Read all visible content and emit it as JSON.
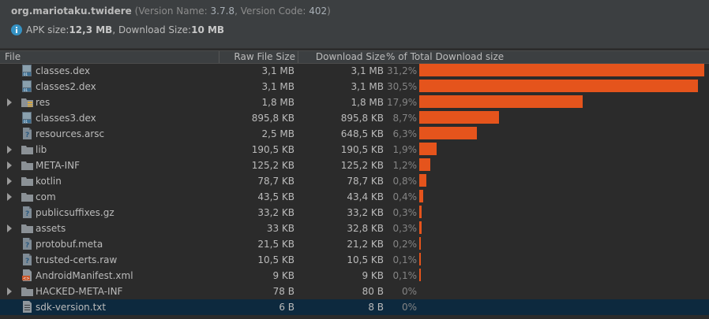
{
  "app": {
    "package": "org.mariotaku.twidere",
    "version_prefix": " (Version Name: ",
    "version_name": "3.7.8",
    "version_mid": ", Version Code: ",
    "version_code": "402",
    "version_suffix": ")"
  },
  "sizes": {
    "apk_label": "APK size: ",
    "apk_value": "12,3 MB",
    "download_label": ", Download Size: ",
    "download_value": "10 MB"
  },
  "columns": {
    "file": "File",
    "raw": "Raw File Size",
    "download": "Download Size",
    "percent": "% of Total Download size"
  },
  "colors": {
    "bar": "#e5541c",
    "selected_row": "#0d293e",
    "background": "#2b2b2b"
  },
  "files": [
    {
      "name": "classes.dex",
      "raw": "3,1 MB",
      "download": "3,1 MB",
      "percent": "31,2%",
      "share": 31.2,
      "expandable": false,
      "icon": "dex-file-icon"
    },
    {
      "name": "classes2.dex",
      "raw": "3,1 MB",
      "download": "3,1 MB",
      "percent": "30,5%",
      "share": 30.5,
      "expandable": false,
      "icon": "dex-file-icon"
    },
    {
      "name": "res",
      "raw": "1,8 MB",
      "download": "1,8 MB",
      "percent": "17,9%",
      "share": 17.9,
      "expandable": true,
      "icon": "resource-folder-icon"
    },
    {
      "name": "classes3.dex",
      "raw": "895,8 KB",
      "download": "895,8 KB",
      "percent": "8,7%",
      "share": 8.7,
      "expandable": false,
      "icon": "dex-file-icon"
    },
    {
      "name": "resources.arsc",
      "raw": "2,5 MB",
      "download": "648,5 KB",
      "percent": "6,3%",
      "share": 6.3,
      "expandable": false,
      "icon": "unknown-file-icon"
    },
    {
      "name": "lib",
      "raw": "190,5 KB",
      "download": "190,5 KB",
      "percent": "1,9%",
      "share": 1.9,
      "expandable": true,
      "icon": "folder-icon"
    },
    {
      "name": "META-INF",
      "raw": "125,2 KB",
      "download": "125,2 KB",
      "percent": "1,2%",
      "share": 1.2,
      "expandable": true,
      "icon": "folder-icon"
    },
    {
      "name": "kotlin",
      "raw": "78,7 KB",
      "download": "78,7 KB",
      "percent": "0,8%",
      "share": 0.8,
      "expandable": true,
      "icon": "folder-icon"
    },
    {
      "name": "com",
      "raw": "43,5 KB",
      "download": "43,4 KB",
      "percent": "0,4%",
      "share": 0.4,
      "expandable": true,
      "icon": "folder-icon"
    },
    {
      "name": "publicsuffixes.gz",
      "raw": "33,2 KB",
      "download": "33,2 KB",
      "percent": "0,3%",
      "share": 0.3,
      "expandable": false,
      "icon": "unknown-file-icon"
    },
    {
      "name": "assets",
      "raw": "33 KB",
      "download": "32,8 KB",
      "percent": "0,3%",
      "share": 0.3,
      "expandable": true,
      "icon": "folder-icon"
    },
    {
      "name": "protobuf.meta",
      "raw": "21,5 KB",
      "download": "21,2 KB",
      "percent": "0,2%",
      "share": 0.2,
      "expandable": false,
      "icon": "unknown-file-icon"
    },
    {
      "name": "trusted-certs.raw",
      "raw": "10,5 KB",
      "download": "10,5 KB",
      "percent": "0,1%",
      "share": 0.1,
      "expandable": false,
      "icon": "unknown-file-icon"
    },
    {
      "name": "AndroidManifest.xml",
      "raw": "9 KB",
      "download": "9 KB",
      "percent": "0,1%",
      "share": 0.1,
      "expandable": false,
      "icon": "xml-file-icon"
    },
    {
      "name": "HACKED-META-INF",
      "raw": "78 B",
      "download": "80 B",
      "percent": "0%",
      "share": 0,
      "expandable": true,
      "icon": "folder-icon"
    },
    {
      "name": "sdk-version.txt",
      "raw": "6 B",
      "download": "8 B",
      "percent": "0%",
      "share": 0,
      "expandable": false,
      "icon": "text-file-icon",
      "selected": true
    }
  ]
}
